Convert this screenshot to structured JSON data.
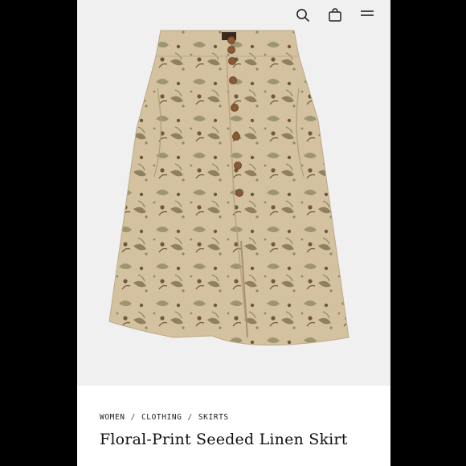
{
  "breadcrumb": {
    "items": [
      "WOMEN",
      "CLOTHING",
      "SKIRTS"
    ],
    "separator": "/"
  },
  "product": {
    "title": "Floral-Print Seeded Linen Skirt",
    "image_alt": "Beige floral-print button-front midi skirt"
  },
  "header": {
    "icons": [
      "search-icon",
      "shopping-bag-icon",
      "menu-icon"
    ]
  },
  "colors": {
    "fabric": "#d2bf9d",
    "print_dark": "#6f5a3a",
    "print_green": "#8e8a62",
    "button": "#8a5a34"
  }
}
